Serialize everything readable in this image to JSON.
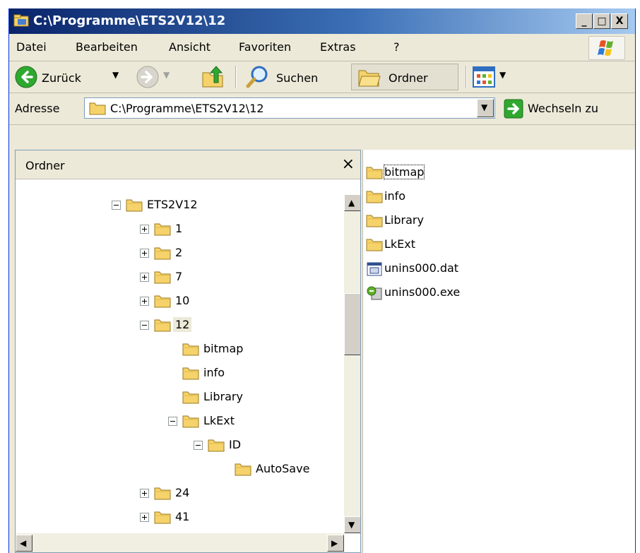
{
  "window": {
    "title": "C:\\Programme\\ETS2V12\\12",
    "buttons": {
      "minimize": "_",
      "maximize": "□",
      "close": "X"
    }
  },
  "menu": [
    "Datei",
    "Bearbeiten",
    "Ansicht",
    "Favoriten",
    "Extras",
    "?"
  ],
  "toolbar": {
    "back_label": "Zurück",
    "search_label": "Suchen",
    "folders_label": "Ordner"
  },
  "address": {
    "label": "Adresse",
    "value": "C:\\Programme\\ETS2V12\\12",
    "go_label": "Wechseln zu"
  },
  "folder_pane": {
    "title": "Ordner",
    "close": "×",
    "tree": [
      {
        "label": "ETS2V12",
        "expander": "minus"
      },
      {
        "label": "1",
        "expander": "plus"
      },
      {
        "label": "2",
        "expander": "plus"
      },
      {
        "label": "7",
        "expander": "plus"
      },
      {
        "label": "10",
        "expander": "plus"
      },
      {
        "label": "12",
        "expander": "minus",
        "selected": true
      },
      {
        "label": "bitmap",
        "expander": "none"
      },
      {
        "label": "info",
        "expander": "none"
      },
      {
        "label": "Library",
        "expander": "none"
      },
      {
        "label": "LkExt",
        "expander": "minus"
      },
      {
        "label": "ID",
        "expander": "minus"
      },
      {
        "label": "AutoSave",
        "expander": "none"
      },
      {
        "label": "24",
        "expander": "plus"
      },
      {
        "label": "41",
        "expander": "plus"
      }
    ]
  },
  "files": [
    {
      "name": "bitmap",
      "icon": "folder-icon"
    },
    {
      "name": "info",
      "icon": "folder-icon"
    },
    {
      "name": "Library",
      "icon": "folder-icon"
    },
    {
      "name": "LkExt",
      "icon": "folder-icon"
    },
    {
      "name": "unins000.dat",
      "icon": "dat-file-icon"
    },
    {
      "name": "unins000.exe",
      "icon": "installer-icon"
    }
  ],
  "colors": {
    "titlebar_start": "#0a246a",
    "titlebar_end": "#a6caf0",
    "chrome": "#ece9d8",
    "folder_yellow": "#f6d36a",
    "go_green": "#2fa82f"
  }
}
